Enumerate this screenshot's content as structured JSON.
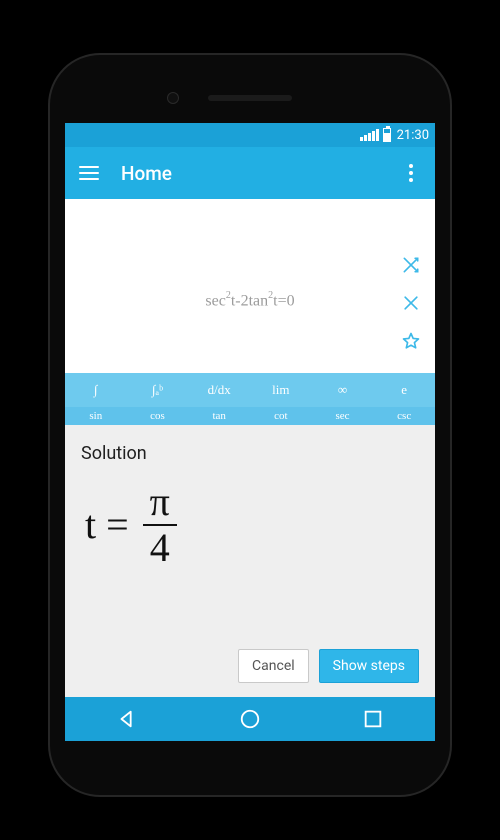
{
  "statusbar": {
    "time": "21:30"
  },
  "actionbar": {
    "title": "Home"
  },
  "input": {
    "equation_parts": {
      "a": "sec",
      "b": "t-2tan",
      "c": "t=0",
      "sup": "2"
    }
  },
  "keyboard": {
    "row1": [
      "∫",
      "∫ₐᵇ",
      "d/dx",
      "lim",
      "∞",
      "e"
    ],
    "row2": [
      "sin",
      "cos",
      "tan",
      "cot",
      "sec",
      "csc"
    ]
  },
  "sheet": {
    "title": "Solution",
    "lhs": "t",
    "eq": "=",
    "numerator": "π",
    "denominator": "4",
    "cancel_label": "Cancel",
    "steps_label": "Show steps"
  }
}
